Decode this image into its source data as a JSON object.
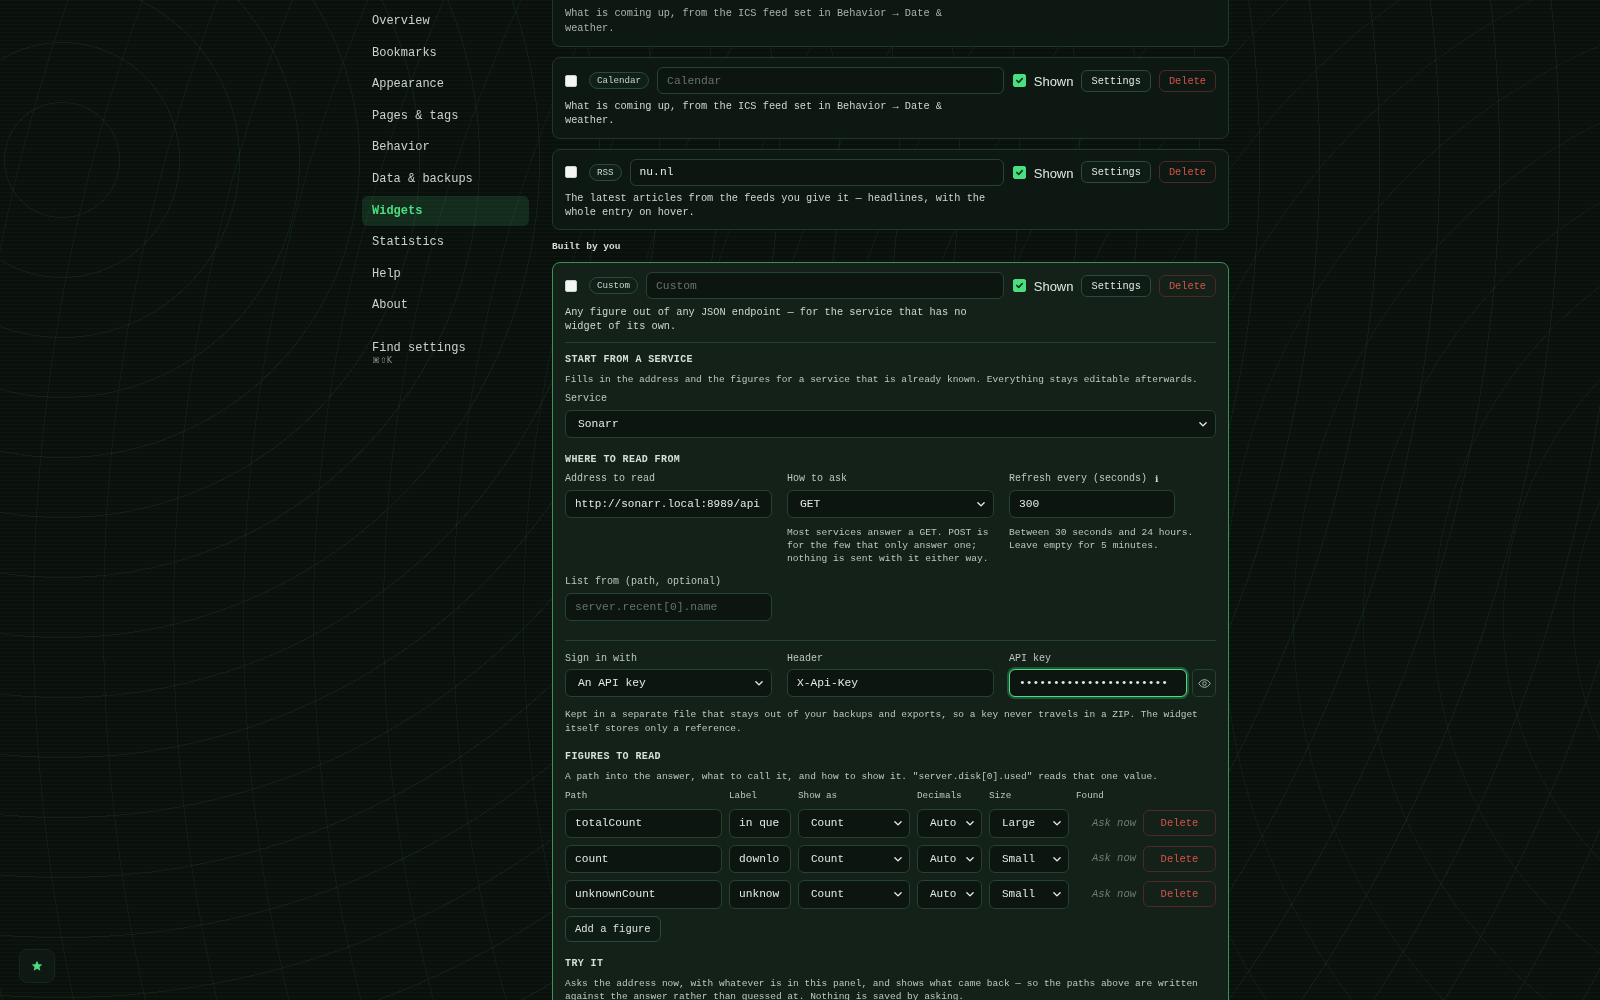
{
  "sidebar": {
    "items": [
      {
        "label": "Overview",
        "selected": false
      },
      {
        "label": "Bookmarks",
        "selected": false
      },
      {
        "label": "Appearance",
        "selected": false
      },
      {
        "label": "Pages & tags",
        "selected": false
      },
      {
        "label": "Behavior",
        "selected": false
      },
      {
        "label": "Data & backups",
        "selected": false
      },
      {
        "label": "Widgets",
        "selected": true
      },
      {
        "label": "Statistics",
        "selected": false
      },
      {
        "label": "Help",
        "selected": false
      },
      {
        "label": "About",
        "selected": false
      }
    ],
    "find": {
      "label": "Find settings",
      "shortcut": "⌘⇧K"
    }
  },
  "clipped_widget": {
    "description": "What is coming up, from the ICS feed set in Behavior → Date & weather."
  },
  "widget_groups": [
    {
      "widgets": [
        {
          "selected": false,
          "tag": "Calendar",
          "name": {
            "placeholder": "Calendar"
          },
          "shown": true,
          "shown_label": "Shown",
          "settings": "Settings",
          "delete": "Delete",
          "description": "What is coming up, from the ICS feed set in Behavior → Date & weather.",
          "expanded": false
        },
        {
          "selected": false,
          "tag": "RSS",
          "name": {
            "value": "nu.nl"
          },
          "shown": true,
          "shown_label": "Shown",
          "settings": "Settings",
          "delete": "Delete",
          "description": "The latest articles from the feeds you give it — headlines, with the whole entry on hover.",
          "expanded": false
        }
      ]
    },
    {
      "heading": "Built by you",
      "widgets": [
        {
          "selected": false,
          "tag": "Custom",
          "name": {
            "placeholder": "Custom"
          },
          "shown": true,
          "shown_label": "Shown",
          "settings": "Settings",
          "delete": "Delete",
          "description": "Any figure out of any JSON endpoint — for the service that has no widget of its own.",
          "expanded": true,
          "panel": {
            "service_section": {
              "heading": "START FROM A SERVICE",
              "help": "Fills in the address and the figures for a service that is already known. Everything stays editable afterwards.",
              "service": {
                "label": "Service",
                "value": "Sonarr"
              }
            },
            "source_section": {
              "heading": "WHERE TO READ FROM",
              "address": {
                "label": "Address to read",
                "value": "http://sonarr.local:8989/api"
              },
              "method": {
                "label": "How to ask",
                "value": "GET",
                "help": "Most services answer a GET. POST is for the few that only answer one; nothing is sent with it either way."
              },
              "refresh": {
                "label": "Refresh every (seconds)",
                "info": "ℹ",
                "value": "300",
                "help": "Between 30 seconds and 24 hours. Leave empty for 5 minutes."
              },
              "list_from": {
                "label": "List from (path, optional)",
                "placeholder": "server.recent[0].name"
              }
            },
            "auth": {
              "sign_in": {
                "label": "Sign in with",
                "value": "An API key"
              },
              "header": {
                "label": "Header",
                "value": "X-Api-Key"
              },
              "api_key": {
                "label": "API key",
                "value": "••••••••••••••••••••••",
                "focused": true
              },
              "help": "Kept in a separate file that stays out of your backups and exports, so a key never travels in a ZIP. The widget itself stores only a reference."
            },
            "figures": {
              "heading": "FIGURES TO READ",
              "help": "A path into the answer, what to call it, and how to show it. \"server.disk[0].used\" reads that one value.",
              "columns": [
                "Path",
                "Label",
                "Show as",
                "Decimals",
                "Size",
                "Found"
              ],
              "rows": [
                {
                  "path": "totalCount",
                  "label": "in que",
                  "show_as": "Count",
                  "decimals": "Auto",
                  "size": "Large",
                  "found": "Ask now",
                  "delete": "Delete"
                },
                {
                  "path": "count",
                  "label": "downlo",
                  "show_as": "Count",
                  "decimals": "Auto",
                  "size": "Small",
                  "found": "Ask now",
                  "delete": "Delete"
                },
                {
                  "path": "unknownCount",
                  "label": "unknow",
                  "show_as": "Count",
                  "decimals": "Auto",
                  "size": "Small",
                  "found": "Ask now",
                  "delete": "Delete"
                }
              ],
              "add": "Add a figure"
            },
            "try_section": {
              "heading": "TRY IT",
              "help": "Asks the address now, with whatever is in this panel, and shows what came back — so the paths above are written against the answer rather than guessed at. Nothing is saved by asking."
            }
          }
        }
      ]
    }
  ]
}
